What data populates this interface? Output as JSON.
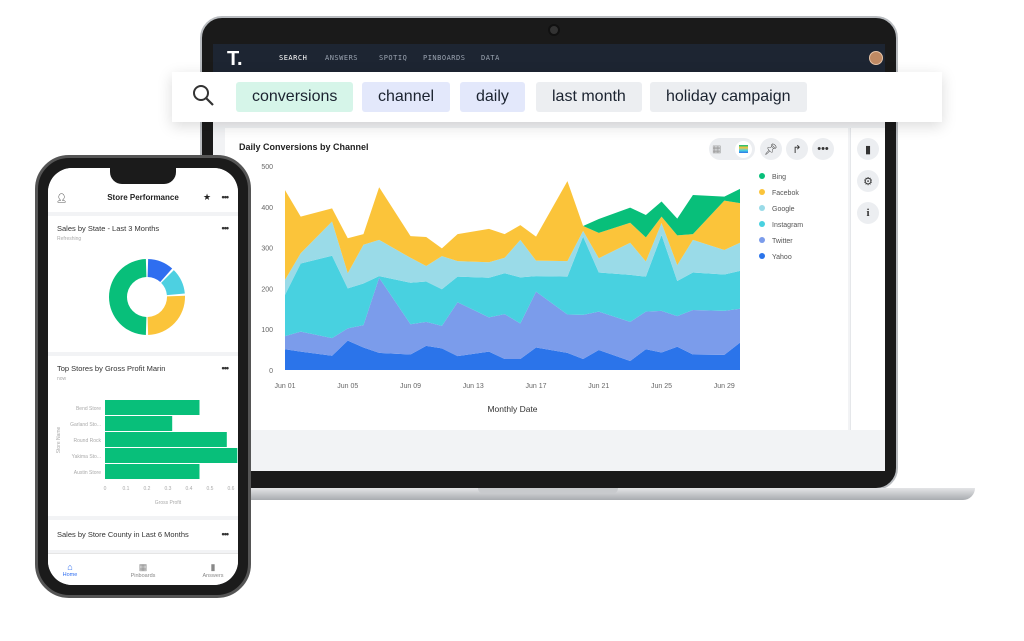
{
  "nav": {
    "logo": "T.",
    "items": [
      "SEARCH",
      "ANSWERS",
      "SPOTIQ",
      "PINBOARDS",
      "DATA"
    ]
  },
  "search": {
    "tokens": [
      {
        "text": "conversions",
        "color": "#d6f5e9"
      },
      {
        "text": "channel",
        "color": "#e3e8fb"
      },
      {
        "text": "daily",
        "color": "#e3e8fb"
      },
      {
        "text": "last month",
        "color": "#eceef1"
      },
      {
        "text": "holiday campaign",
        "color": "#eceef1"
      }
    ]
  },
  "answer": {
    "title": "Daily Conversions by Channel",
    "toolbar_icons": [
      "table-icon",
      "area-chart-icon",
      "pin-icon",
      "share-icon",
      "more-icon"
    ],
    "side_icons": [
      "bar-chart-icon",
      "gear-icon",
      "info-icon"
    ]
  },
  "chart_data": {
    "type": "area",
    "stacked": true,
    "title": "Daily Conversions by Channel",
    "xlabel": "Monthly Date",
    "ylabel": "",
    "ylim": [
      0,
      500
    ],
    "yticks": [
      0,
      100,
      200,
      300,
      400,
      500
    ],
    "xticks": [
      "Jun 01",
      "Jun 05",
      "Jun 09",
      "Jun 13",
      "Jun 17",
      "Jun 21",
      "Jun 25",
      "Jun 29"
    ],
    "xlim": [
      "Jun 01",
      "Jun 30"
    ],
    "grid": false,
    "legend": "right",
    "x": [
      "Jun 01",
      "Jun 02",
      "Jun 04",
      "Jun 05",
      "Jun 06",
      "Jun 07",
      "Jun 09",
      "Jun 10",
      "Jun 11",
      "Jun 12",
      "Jun 14",
      "Jun 15",
      "Jun 16",
      "Jun 17",
      "Jun 19",
      "Jun 20",
      "Jun 21",
      "Jun 23",
      "Jun 24",
      "Jun 25",
      "Jun 26",
      "Jun 27",
      "Jun 29",
      "Jun 30"
    ],
    "series": [
      {
        "name": "Yahoo",
        "color": "#2b74ea",
        "values": [
          51,
          45,
          35,
          72,
          55,
          42,
          38,
          59,
          53,
          34,
          45,
          27,
          27,
          55,
          42,
          27,
          49,
          22,
          51,
          43,
          57,
          38,
          37,
          67
        ]
      },
      {
        "name": "Twitter",
        "color": "#7b9ceb",
        "values": [
          32,
          49,
          43,
          30,
          55,
          184,
          74,
          59,
          55,
          132,
          84,
          110,
          87,
          137,
          94,
          108,
          94,
          96,
          92,
          102,
          75,
          109,
          108,
          83
        ]
      },
      {
        "name": "Instagram",
        "color": "#48d1e0",
        "values": [
          101,
          167,
          202,
          98,
          102,
          4,
          102,
          99,
          90,
          63,
          97,
          100,
          113,
          38,
          93,
          192,
          96,
          115,
          86,
          186,
          86,
          92,
          89,
          93
        ]
      },
      {
        "name": "Google",
        "color": "#9adbe8",
        "values": [
          37,
          25,
          84,
          37,
          95,
          89,
          61,
          38,
          81,
          38,
          38,
          38,
          92,
          38,
          38,
          14,
          35,
          79,
          37,
          29,
          39,
          80,
          60,
          69
        ]
      },
      {
        "name": "Facebok",
        "color": "#fbc43a",
        "values": [
          220,
          90,
          32,
          86,
          26,
          129,
          53,
          71,
          19,
          66,
          82,
          58,
          36,
          59,
          196,
          12,
          62,
          49,
          59,
          16,
          73,
          14,
          121,
          97
        ]
      },
      {
        "name": "Bing",
        "color": "#08bf7a",
        "values": [
          0,
          0,
          0,
          0,
          0,
          0,
          0,
          0,
          0,
          0,
          0,
          0,
          0,
          0,
          0,
          0,
          34,
          37,
          55,
          37,
          41,
          96,
          10,
          35
        ]
      }
    ]
  },
  "phone": {
    "title": "Store Performance",
    "card1": {
      "title": "Sales by State - Last 3 Months",
      "status": "Refreshing",
      "chart_data": {
        "type": "pie",
        "donut": true,
        "values": [
          12,
          12,
          26,
          50
        ],
        "colors": [
          "#2f6ef0",
          "#4dd0e1",
          "#fbc43a",
          "#08bf7a"
        ]
      }
    },
    "card2": {
      "title": "Top Stores by Gross Profit Marin",
      "status": "now",
      "chart_data": {
        "type": "bar",
        "orientation": "horizontal",
        "categories": [
          "Bend Store",
          "Garland Sto...",
          "Round Rock",
          "Yakima Sto...",
          "Austin Store"
        ],
        "values": [
          0.45,
          0.32,
          0.58,
          0.63,
          0.45
        ],
        "xlabel": "Gross Profit",
        "ylabel": "Store Name",
        "xlim": [
          0,
          0.6
        ],
        "xticks": [
          "0",
          "0.1",
          "0.2",
          "0.3",
          "0.4",
          "0.5",
          "0.6"
        ],
        "color": "#08bf7a"
      }
    },
    "card3": {
      "title": "Sales by Store County in Last 6 Months"
    },
    "tabs": [
      {
        "label": "Home",
        "active": true
      },
      {
        "label": "Pinboards"
      },
      {
        "label": "Answers"
      }
    ]
  }
}
